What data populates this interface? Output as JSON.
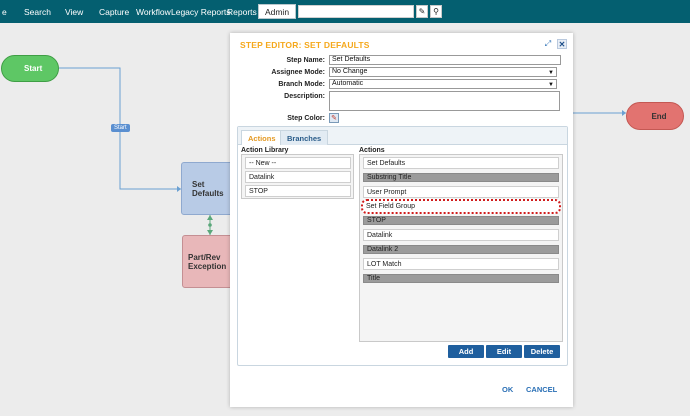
{
  "nav": {
    "items": [
      "e",
      "Search",
      "View",
      "Capture",
      "Workflow",
      "Legacy Reports",
      "Reports"
    ],
    "admin_label": "Admin",
    "search_value": "",
    "eraser_glyph": "✎",
    "search_glyph": "⚲"
  },
  "workflow": {
    "start_label": "Start",
    "end_label": "End",
    "set_defaults_label": "Set Defaults",
    "partrev_label_1": "Part/Rev",
    "partrev_label_2": "Exception",
    "edge_label": "Start",
    "colors": {
      "start": "#5ec765",
      "end": "#e27370",
      "step": "#b8cbe6",
      "exception": "#e8b7b9",
      "edge": "#5a8fd0"
    }
  },
  "modal": {
    "title": "STEP EDITOR: SET DEFAULTS",
    "expand_glyph": "⤢",
    "close_glyph": "✕",
    "step_name_label": "Step Name:",
    "step_name_value": "Set Defaults",
    "assignee_label": "Assignee Mode:",
    "assignee_value": "No Change",
    "branch_label": "Branch Mode:",
    "branch_value": "Automatic",
    "description_label": "Description:",
    "step_color_label": "Step Color:",
    "tabs": [
      "Actions",
      "Branches"
    ],
    "library_title": "Action Library",
    "library_items": [
      "-- New --",
      "Datalink",
      "STOP"
    ],
    "actions_title": "Actions",
    "actions": [
      "Set Defaults",
      "Substring Title",
      "User Prompt",
      "Set Field Group",
      "STOP",
      "Datalink",
      "Datalink 2",
      "LOT Match",
      "Title"
    ],
    "add_label": "Add",
    "edit_label": "Edit",
    "delete_label": "Delete",
    "ok_label": "OK",
    "cancel_label": "CANCEL",
    "accent_color": "#f5a81c",
    "button_color": "#1f5f9e"
  }
}
